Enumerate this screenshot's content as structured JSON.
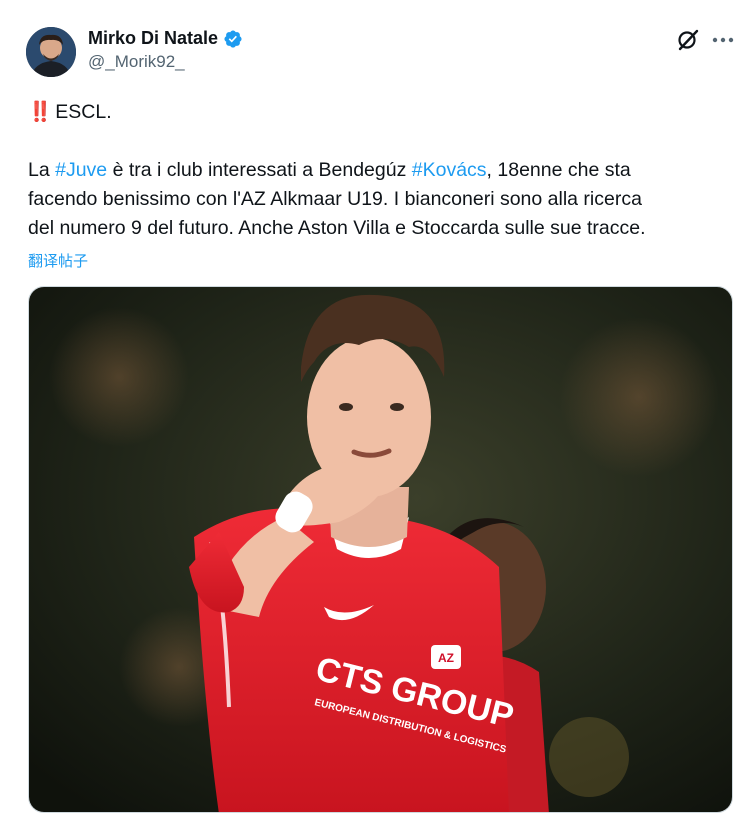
{
  "author": {
    "display_name": "Mirko Di Natale",
    "handle": "@_Morik92_",
    "verified_icon": "verified-badge-icon"
  },
  "header_actions": {
    "grok_icon": "grok-icon",
    "more_icon": "more-horizontal-icon"
  },
  "tweet": {
    "line1_emoji": "‼️",
    "line1_text": "ESCL.",
    "p1_a": "La ",
    "p1_hashtag1": "#Juve",
    "p1_b": " è tra i club interessati a Bendegúz ",
    "p1_hashtag2": "#Kovács",
    "p1_c": ", 18enne che sta",
    "p2": "facendo benissimo con l'AZ Alkmaar U19. I bianconeri sono alla ricerca",
    "p3": "del numero 9 del futuro. Anche Aston Villa e Stoccarda sulle sue tracce."
  },
  "translate_label": "翻译帖子",
  "media": {
    "shirt_text_main": "CTS GROUP",
    "shirt_text_sub": "EUROPEAN DISTRIBUTION & LOGISTICS",
    "badge_text": "AZ",
    "colors": {
      "shirt_red": "#e8232f",
      "background_dark": "#1a1d14"
    }
  },
  "colors": {
    "link": "#1d9bf0",
    "text": "#0f1419",
    "secondary": "#536471"
  }
}
